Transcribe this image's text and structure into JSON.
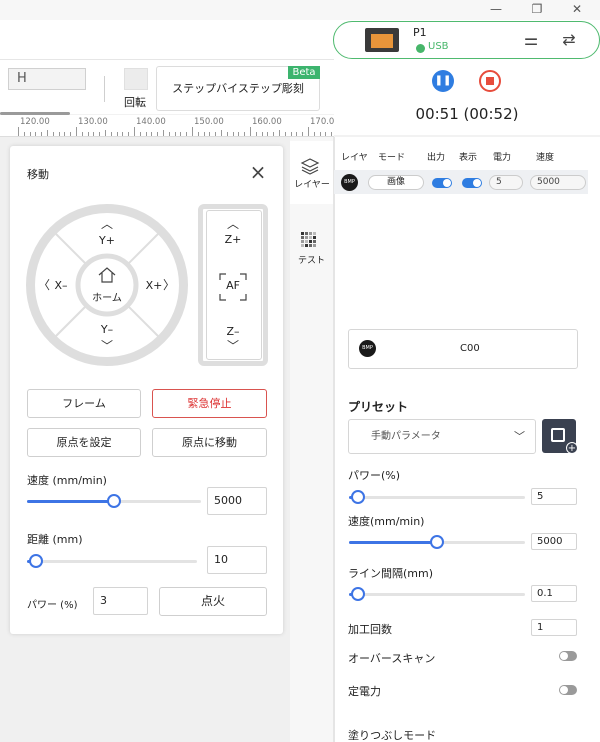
{
  "window": {
    "minimize_icon": "minimize-icon",
    "maximize_icon": "restore-icon",
    "close_icon": "close-icon"
  },
  "toolbar": {
    "height_field": "H",
    "rotate_label": "回転",
    "step_button": "ステップバイステップ彫刻",
    "beta_badge": "Beta"
  },
  "ruler": {
    "ticks": [
      "120.00",
      "130.00",
      "140.00",
      "150.00",
      "160.00",
      "170.0"
    ]
  },
  "move_panel": {
    "title": "移動",
    "jog": {
      "y_plus": "Y+",
      "y_minus": "Y–",
      "x_minus": "X–",
      "x_plus": "X+",
      "home": "ホーム"
    },
    "z": {
      "z_plus": "Z+",
      "af": "AF",
      "z_minus": "Z–"
    },
    "buttons": {
      "frame": "フレーム",
      "emergency_stop": "緊急停止",
      "set_origin": "原点を設定",
      "go_to_origin": "原点に移動",
      "ignite": "点火"
    },
    "speed": {
      "label": "速度 (mm/min)",
      "value": "5000",
      "level": 0.5
    },
    "distance": {
      "label": "距離 (mm)",
      "value": "10",
      "level": 0.05
    },
    "power": {
      "label": "パワー (%)",
      "value": "3"
    }
  },
  "side_tabs": {
    "layer": "レイヤー",
    "test": "テスト"
  },
  "device": {
    "name": "P1",
    "connection": "USB",
    "status_color": "#47b66a"
  },
  "job": {
    "timer": "00:51 (00:52)"
  },
  "layers": {
    "headers": [
      "レイヤ",
      "モード",
      "出力",
      "表示",
      "電力",
      "速度"
    ],
    "rows": [
      {
        "icon": "BMP",
        "mode": "画像",
        "output": true,
        "visible": true,
        "power": "5",
        "speed": "5000"
      }
    ]
  },
  "selected_layer": {
    "icon": "BMP",
    "name": "C00"
  },
  "settings": {
    "preset_title": "プリセット",
    "preset_value": "手動パラメータ",
    "power": {
      "label": "パワー(%)",
      "value": "5",
      "level": 0.05
    },
    "speed": {
      "label": "速度(mm/min)",
      "value": "5000",
      "level": 0.5
    },
    "line_interval": {
      "label": "ライン間隔(mm)",
      "value": "0.1",
      "level": 0.05
    },
    "passes": {
      "label": "加工回数",
      "value": "1"
    },
    "overscan": {
      "label": "オーバースキャン",
      "enabled": false
    },
    "constant_power": {
      "label": "定電力",
      "enabled": false
    },
    "fill_mode": {
      "label": "塗りつぶしモード"
    }
  },
  "colors": {
    "accent": "#3d74e5",
    "danger": "#d33",
    "connected": "#4fba6f"
  }
}
